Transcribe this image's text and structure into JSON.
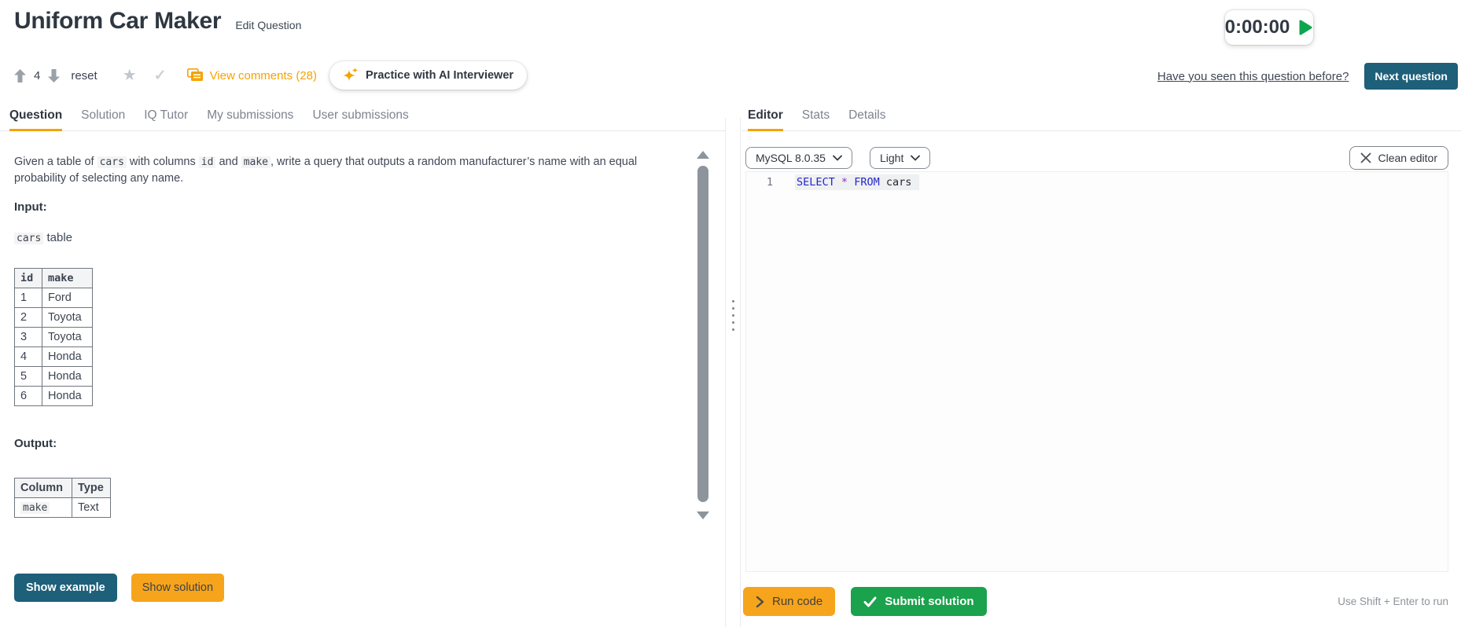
{
  "header": {
    "title": "Uniform Car Maker",
    "edit_question": "Edit Question",
    "timer": "0:00:00",
    "upvotes": "4",
    "reset": "reset",
    "view_comments": "View comments (28)",
    "practice_ai": "Practice with AI Interviewer",
    "seen_before": "Have you seen this question before?",
    "next_question": "Next question"
  },
  "left_panel": {
    "tabs": [
      "Question",
      "Solution",
      "IQ Tutor",
      "My submissions",
      "User submissions"
    ],
    "active_tab": "Question",
    "question_segments": [
      {
        "type": "text",
        "value": "Given a table of "
      },
      {
        "type": "code",
        "value": "cars"
      },
      {
        "type": "text",
        "value": " with columns "
      },
      {
        "type": "code",
        "value": "id"
      },
      {
        "type": "text",
        "value": " and "
      },
      {
        "type": "code",
        "value": "make"
      },
      {
        "type": "text",
        "value": ", write a query that outputs a random manufacturer’s name with an equal probability of selecting any name."
      }
    ],
    "input_label": "Input:",
    "input_caption": {
      "code": "cars",
      "text": " table"
    },
    "input_table": {
      "headers": [
        "id",
        "make"
      ],
      "rows": [
        [
          "1",
          "Ford"
        ],
        [
          "2",
          "Toyota"
        ],
        [
          "3",
          "Toyota"
        ],
        [
          "4",
          "Honda"
        ],
        [
          "5",
          "Honda"
        ],
        [
          "6",
          "Honda"
        ]
      ]
    },
    "output_label": "Output:",
    "output_table": {
      "headers": [
        "Column",
        "Type"
      ],
      "rows": [
        [
          "make",
          "Text"
        ]
      ]
    },
    "show_example": "Show example",
    "show_solution": "Show solution"
  },
  "right_panel": {
    "tabs": [
      "Editor",
      "Stats",
      "Details"
    ],
    "active_tab": "Editor",
    "language_select": "MySQL 8.0.35",
    "theme_select": "Light",
    "clean_editor": "Clean editor",
    "editor": {
      "line_number": "1",
      "tokens": [
        {
          "type": "keyword",
          "value": "SELECT"
        },
        {
          "type": "plain",
          "value": " "
        },
        {
          "type": "operator",
          "value": "*"
        },
        {
          "type": "plain",
          "value": " "
        },
        {
          "type": "keyword",
          "value": "FROM"
        },
        {
          "type": "plain",
          "value": " cars"
        }
      ]
    },
    "run_code": "Run code",
    "submit_solution": "Submit solution",
    "run_hint": "Use Shift + Enter to run"
  },
  "colors": {
    "accent_orange": "#F5A302",
    "button_orange": "#F6A41C",
    "teal": "#1E5F79",
    "green": "#1BA24C",
    "play_green": "#0CA64E",
    "keyword_blue": "#2525CC",
    "operator_purple": "#8A2FC9"
  }
}
